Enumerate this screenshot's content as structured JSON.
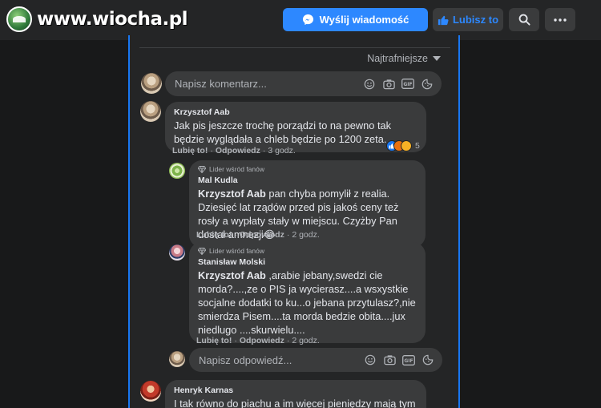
{
  "site": {
    "logo_text": "www.wiocha.pl"
  },
  "topbar": {
    "send_message_label": "Wyślij wiadomość",
    "like_label": "Lubisz to"
  },
  "sort": {
    "label": "Najtrafniejsze"
  },
  "composer": {
    "placeholder": "Napisz komentarz..."
  },
  "reply_composer": {
    "placeholder": "Napisz odpowiedź..."
  },
  "actions": {
    "like": "Lubię to!",
    "reply": "Odpowiedz",
    "dot": "·"
  },
  "comments": [
    {
      "author": "Krzysztof Aab",
      "text": "Jak pis jeszcze trochę porządzi to na pewno tak będzie wyglądała a chleb będzie po 1200 zeta.",
      "time": "3 godz.",
      "reaction_count": "5"
    },
    {
      "badge": "Lider wśród fanów",
      "author": "Mal Kudla",
      "mention": "Krzysztof Aab",
      "text": " pan chyba pomylił z realia. Dziesięć lat rządów przed pis jakoś ceny też rosły a wypłaty stały w miejscu. Czyżby Pan dostał amnezji",
      "emoji": "😂",
      "time": "2 godz."
    },
    {
      "badge": "Lider wśród fanów",
      "author": "Stanisław Molski",
      "mention": "Krzysztof Aab",
      "text": " ,arabie jebany,swedzi cie morda?....,ze o PIS ja wycierasz....a wsxystkie socjalne dodatki to ku...o jebana przytulasz?,nie smierdza Pisem....ta morda bedzie obita....jux niedlugo ....skurwielu....",
      "time": "2 godz."
    },
    {
      "author": "Henryk Karnas",
      "text": "I tak równo do piachu a im więcej pieniędzy mają tym"
    }
  ],
  "colors": {
    "accent": "#2d88ff",
    "panel_border": "#1877f2",
    "background": "#18191a",
    "panel": "#242526",
    "bubble": "#3a3b3c"
  }
}
